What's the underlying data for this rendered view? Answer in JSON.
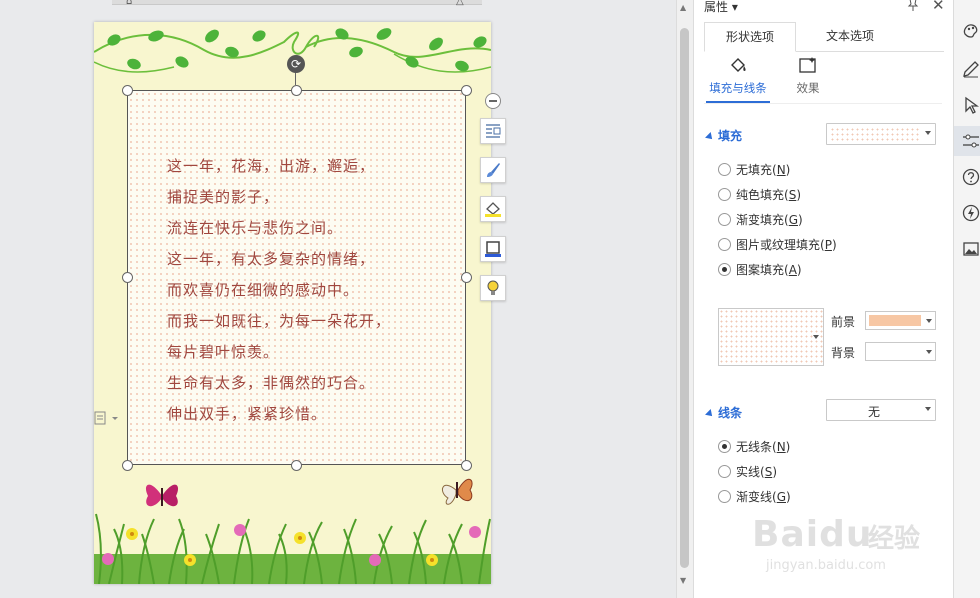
{
  "document": {
    "poem_lines": [
      "这一年，花海，出游，邂逅，",
      "捕捉美的影子，",
      "流连在快乐与悲伤之间。",
      "这一年，有太多复杂的情绪，",
      "而欢喜仍在细微的感动中。",
      "而我一如既往，为每一朵花开，",
      "每片碧叶惊羡。",
      "生命有太多，非偶然的巧合。",
      "伸出双手，紧紧珍惜。"
    ]
  },
  "panel": {
    "title": "属性",
    "tabs": [
      "形状选项",
      "文本选项"
    ],
    "subtabs": [
      "填充与线条",
      "效果"
    ],
    "fill": {
      "section_title": "填充",
      "options": [
        {
          "text": "无填充(",
          "key": "N",
          "tail": ")",
          "checked": false
        },
        {
          "text": "纯色填充(",
          "key": "S",
          "tail": ")",
          "checked": false
        },
        {
          "text": "渐变填充(",
          "key": "G",
          "tail": ")",
          "checked": false
        },
        {
          "text": "图片或纹理填充(",
          "key": "P",
          "tail": ")",
          "checked": false
        },
        {
          "text": "图案填充(",
          "key": "A",
          "tail": ")",
          "checked": true
        }
      ],
      "foreground_label": "前景",
      "background_label": "背景",
      "foreground_color": "#f7c7a4",
      "background_color": "#ffffff"
    },
    "line": {
      "section_title": "线条",
      "value": "无",
      "options": [
        {
          "text": "无线条(",
          "key": "N",
          "tail": ")",
          "checked": true
        },
        {
          "text": "实线(",
          "key": "S",
          "tail": ")",
          "checked": false
        },
        {
          "text": "渐变线(",
          "key": "G",
          "tail": ")",
          "checked": false
        }
      ]
    }
  },
  "watermark": {
    "logo": "Baidu",
    "cn": "经验",
    "url": "jingyan.baidu.com"
  },
  "colors": {
    "accent": "#2d6dd6",
    "poem_text": "#a0473f",
    "page_bg": "#f8f6cf",
    "pattern_dot": "#f1c8b4"
  }
}
